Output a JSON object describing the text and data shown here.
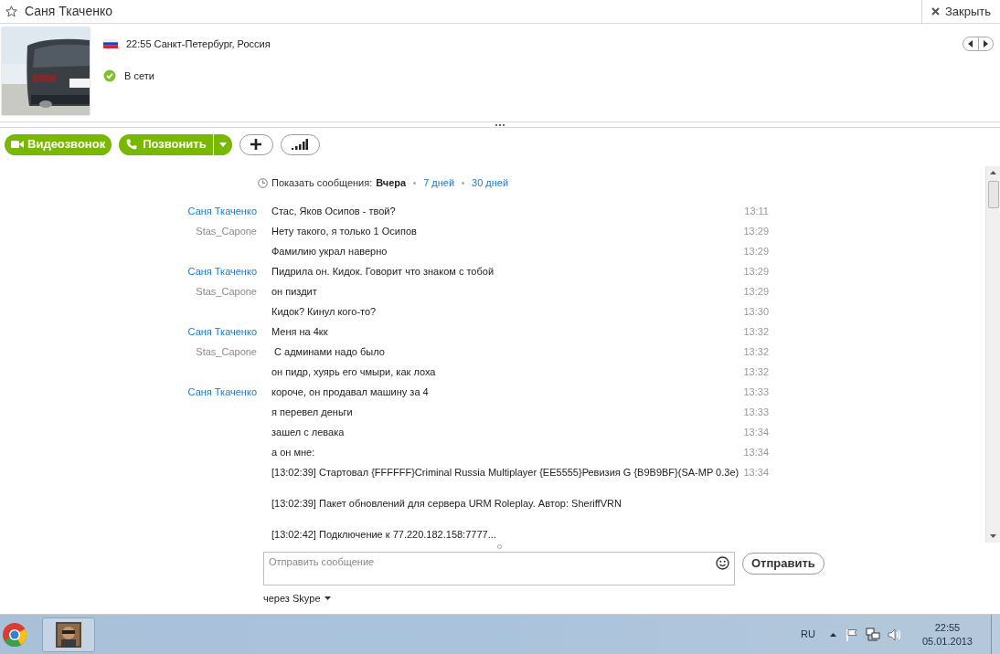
{
  "header": {
    "title": "Саня Ткаченко",
    "close_label": "Закрыть"
  },
  "profile": {
    "location": "22:55 Санкт-Петербург, Россия",
    "status": "В сети"
  },
  "toolbar": {
    "video_call": "Видеозвонок",
    "call": "Позвонить"
  },
  "history": {
    "label": "Показать сообщения:",
    "options": [
      {
        "label": "Вчера",
        "selected": true
      },
      {
        "label": "7 дней",
        "selected": false
      },
      {
        "label": "30 дней",
        "selected": false
      }
    ]
  },
  "messages": [
    {
      "sender": {
        "name": "Саня Ткаченко",
        "kind": "contact"
      },
      "text": "Стас, Яков Осипов - твой?",
      "time": "13:11"
    },
    {
      "sender": {
        "name": "Stas_Capone",
        "kind": "self"
      },
      "text": "Нету такого, я только 1 Осипов",
      "time": "13:29"
    },
    {
      "text": "Фамилию украл наверно",
      "time": "13:29"
    },
    {
      "sender": {
        "name": "Саня Ткаченко",
        "kind": "contact"
      },
      "text": "Пидрила он. Кидок. Говорит что знаком с тобой",
      "time": "13:29"
    },
    {
      "sender": {
        "name": "Stas_Capone",
        "kind": "self"
      },
      "text": "он пиздит",
      "time": "13:29"
    },
    {
      "text": "Кидок? Кинул кого-то?",
      "time": "13:30"
    },
    {
      "sender": {
        "name": "Саня Ткаченко",
        "kind": "contact"
      },
      "text": "Меня на 4кк",
      "time": "13:32"
    },
    {
      "sender": {
        "name": "Stas_Capone",
        "kind": "self"
      },
      "text": " С админами надо было",
      "time": "13:32"
    },
    {
      "text": "он пидр, хуярь его чмыри, как лоха",
      "time": "13:32"
    },
    {
      "sender": {
        "name": "Саня Ткаченко",
        "kind": "contact"
      },
      "text": "короче, он продавал машину за 4",
      "time": "13:33"
    },
    {
      "text": "я перевел деньги",
      "time": "13:33"
    },
    {
      "text": "зашел с левака",
      "time": "13:34"
    },
    {
      "text": "а он мне:",
      "time": "13:34"
    },
    {
      "text": "[13:02:39] Стартовал {FFFFFF}Criminal Russia Multiplayer {EE5555}Ревизия G {B9B9BF}(SA-MP 0.3e)",
      "time": "13:34"
    },
    {
      "text": "[13:02:39] Пакет обновлений для сервера URM Roleplay. Автор: SheriffVRN",
      "spaced": true
    },
    {
      "text": "[13:02:42] Подключение к 77.220.182.158:7777...",
      "spaced": true
    }
  ],
  "composer": {
    "placeholder": "Отправить сообщение",
    "send": "Отправить",
    "via": "через Skype"
  },
  "taskbar": {
    "language": "RU",
    "time": "22:55",
    "date": "05.01.2013"
  }
}
